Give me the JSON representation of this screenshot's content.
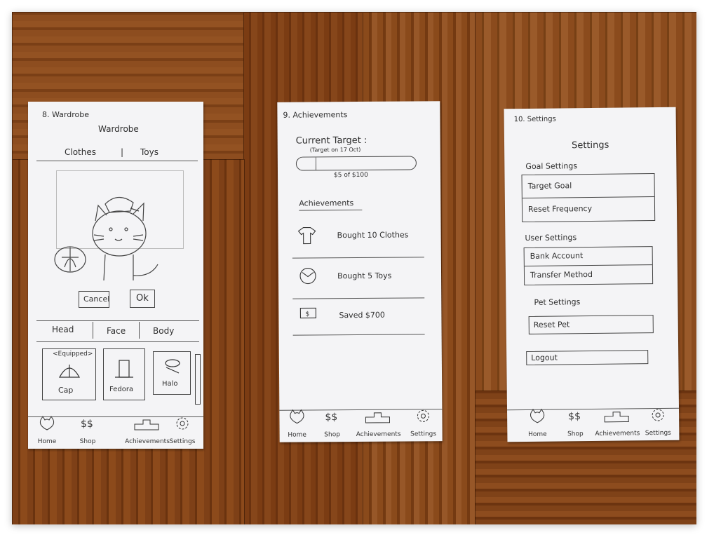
{
  "sheet1": {
    "number_label": "8. Wardrobe",
    "title": "Wardrobe",
    "tab_clothes": "Clothes",
    "tab_toys": "Toys",
    "cancel": "Cancel",
    "ok": "Ok",
    "cat_head": "Head",
    "cat_face": "Face",
    "cat_body": "Body",
    "equipped": "<Equipped>",
    "item_cap": "Cap",
    "item_fedora": "Fedora",
    "item_halo": "Halo"
  },
  "sheet2": {
    "number_label": "9. Achievements",
    "current_target": "Current Target :",
    "target_note": "(Target on 17 Oct)",
    "progress_text": "$5 of $100",
    "section": "Achievements",
    "rows": [
      {
        "label": "Bought 10 Clothes",
        "icon": "shirt-icon"
      },
      {
        "label": "Bought 5 Toys",
        "icon": "ball-icon"
      },
      {
        "label": "Saved $700",
        "icon": "money-icon"
      }
    ]
  },
  "sheet3": {
    "number_label": "10. Settings",
    "title": "Settings",
    "goal_settings": "Goal Settings",
    "target_goal": "Target Goal",
    "reset_frequency": "Reset Frequency",
    "user_settings": "User Settings",
    "bank_account": "Bank Account",
    "transfer_method": "Transfer Method",
    "pet_settings": "Pet Settings",
    "reset_pet": "Reset Pet",
    "logout": "Logout"
  },
  "nav": {
    "home": "Home",
    "shop": "Shop",
    "achievements": "Achievements",
    "settings": "Settings"
  }
}
